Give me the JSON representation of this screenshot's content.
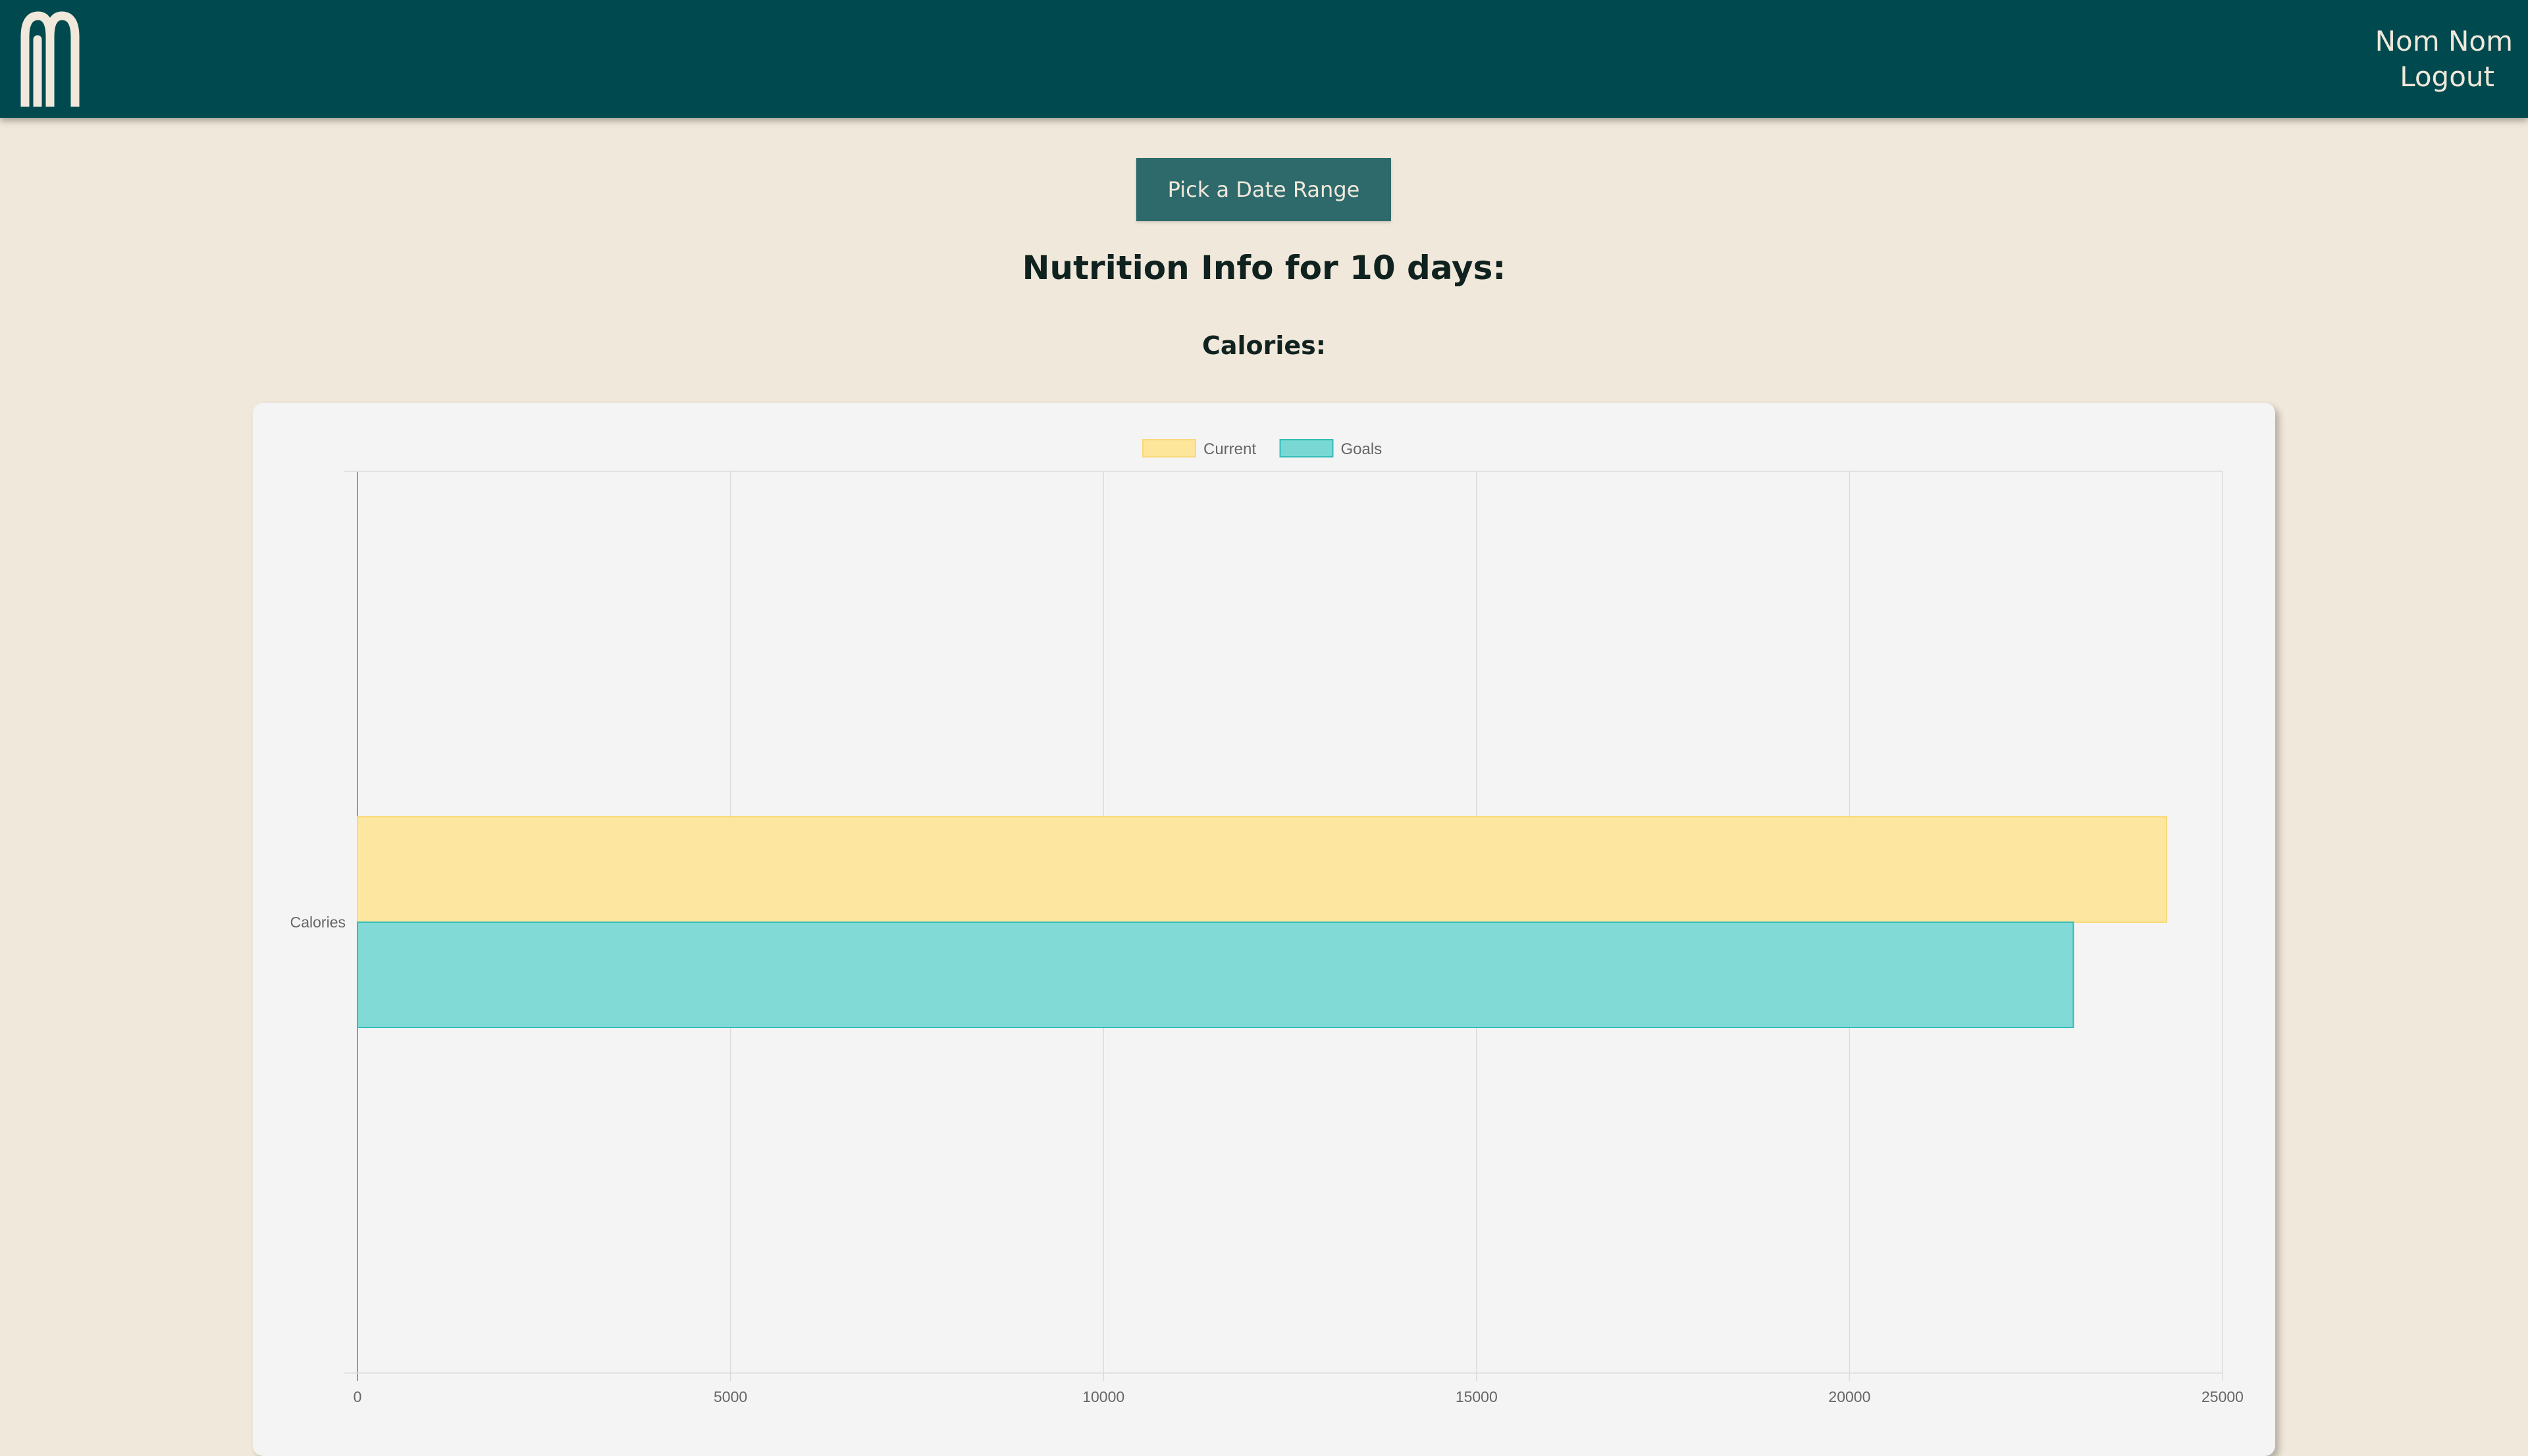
{
  "header": {
    "logo_icon": "fork-logo-icon",
    "user_name": "Nom Nom",
    "logout_label": "Logout"
  },
  "main": {
    "pick_date_label": "Pick a Date Range",
    "title": "Nutrition Info for 10 days:",
    "section_title": "Calories:"
  },
  "colors": {
    "header_bg": "#004a4f",
    "page_bg": "#f0e8da",
    "button_bg": "#2e6a6c",
    "current_fill": "#fde59a",
    "current_border": "#f9d97a",
    "goals_fill": "#7ad8d4",
    "goals_border": "#36bcb8"
  },
  "chart_data": {
    "type": "bar",
    "orientation": "horizontal",
    "categories": [
      "Calories"
    ],
    "series": [
      {
        "name": "Current",
        "values": [
          24250
        ]
      },
      {
        "name": "Goals",
        "values": [
          23000
        ]
      }
    ],
    "xlim": [
      0,
      25000
    ],
    "xticks": [
      "0",
      "5000",
      "10000",
      "15000",
      "20000",
      "25000"
    ],
    "grid": true,
    "legend_position": "top-center"
  }
}
